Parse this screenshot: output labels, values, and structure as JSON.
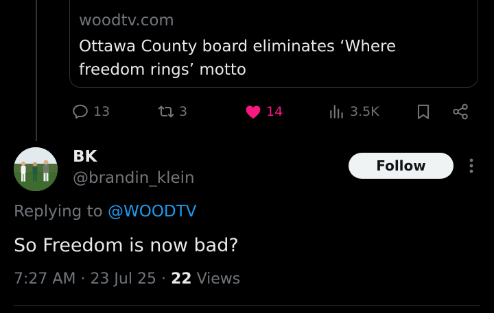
{
  "quoted_card": {
    "domain": "woodtv.com",
    "title": "Ottawa County board eliminates ‘Where freedom rings’ motto"
  },
  "actions": {
    "replies": "13",
    "reposts": "3",
    "likes": "14",
    "views": "3.5K"
  },
  "reply": {
    "display_name": "BK",
    "handle": "@brandin_klein",
    "follow_label": "Follow",
    "replying_prefix": "Replying to",
    "replying_to": "@WOODTV",
    "text": "So Freedom is now bad?",
    "time": "7:27 AM",
    "date": "23 Jul 25",
    "views_count": "22",
    "views_label": "Views"
  },
  "colors": {
    "background": "#000000",
    "text": "#e7e9ea",
    "muted": "#71767b",
    "link": "#1d9bf0",
    "like": "#f91880",
    "follow_bg": "#eff3f4"
  }
}
